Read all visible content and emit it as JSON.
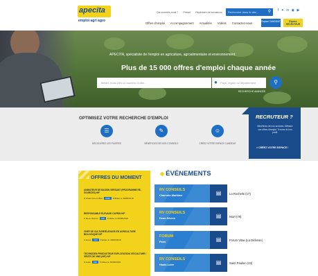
{
  "header": {
    "logo_text": "apecita",
    "tagline": "emploi agri agro",
    "top_links": [
      "Qui sommes-nous ?",
      "Presse",
      "Répertoire de formations"
    ],
    "search_placeholder": "Recherche dans le site...",
    "social_icons": [
      "facebook-icon",
      "twitter-icon",
      "linkedin-icon",
      "instagram-icon",
      "youtube-icon"
    ],
    "nav": [
      "Offres d'emploi",
      "Accompagnement",
      "Actualités",
      "Vidéos",
      "Contactez-nous"
    ],
    "badge_candidat": "Espace CANDIDAT",
    "badge_recruteur": "Espace RECRUTEUR"
  },
  "hero": {
    "subtitle": "APECITA, spécialiste de l'emploi en agriculture, agroalimentaire et environnement",
    "title": "Plus de 15 000 offres d'emploi chaque année",
    "job_placeholder": "Métier, mots clés ou numéro d'offre...",
    "location_placeholder": "Pays, région ou département",
    "advanced_link": "RECHERCHE AVANCÉE"
  },
  "optimize": {
    "title": "OPTIMISEZ VOTRE RECHERCHE D'EMPLOI",
    "features": [
      {
        "label": "DÉCOUVREZ LES FILIÈRES",
        "icon": "sectors-icon"
      },
      {
        "label": "BÉNÉFICIEZ DE NOS CONSEILS",
        "icon": "advice-icon"
      },
      {
        "label": "CRÉEZ VOTRE ESPACE CANDIDAT",
        "icon": "candidate-space-icon"
      }
    ]
  },
  "recruteur": {
    "title": "RECRUTEUR ?",
    "description": "Bénéficiez de nos services. Diffusez vos offres d'emploi. Trouvez le bon profil.",
    "cta": "> CRÉEZ VOTRE ESPACE !"
  },
  "offres": {
    "title": "OFFRES DU MOMENT",
    "items": [
      {
        "title": "ANIMATEUR DE BASSIN VERSANT (PROGRAMME RE-SOURCES) H/F",
        "location": "Chaumes-en-Brie",
        "contract": "CDD",
        "date": "Publiée le 30/08/2018"
      },
      {
        "title": "RESPONSABLE ÉLEVAGE CAPRIN H/F",
        "location": "Deux-Sèvres",
        "contract": "CDI",
        "date": "Publiée le 30/08/2018"
      },
      {
        "title": "CHEF DE CULTURE/ÉLEVAGE EN AGRICULTURE BIOLOGIQUE H/F",
        "location": "Aisne",
        "contract": "CDI",
        "date": "Publiée le 30/08/2018"
      },
      {
        "title": "TECHNICIEN PRODUCTEUR EXPLOITATION VITICULTURE / VENTE DE VINS (H/F) H/F",
        "location": "Aude",
        "contract": "CDI",
        "date": "Publiée le 30/08/2018"
      }
    ]
  },
  "evenements": {
    "title": "ÉVÉNEMENTS",
    "items": [
      {
        "name": "RV CONSEILS",
        "place": "Charente-Maritime",
        "city": "La Rochelle (17)"
      },
      {
        "name": "RV CONSEILS",
        "place": "Deux-Sèvres",
        "city": "Niort (79)"
      },
      {
        "name": "FORUM",
        "place": "Paris",
        "city": "Forum Vitae (La Défense)"
      },
      {
        "name": "RV CONSEILS",
        "place": "Haute-Loire",
        "city": "Saint Paulien (43)"
      }
    ]
  },
  "colors": {
    "brand_blue": "#1e6fc4",
    "brand_navy": "#1a4c8c",
    "brand_yellow": "#f2d21b"
  }
}
